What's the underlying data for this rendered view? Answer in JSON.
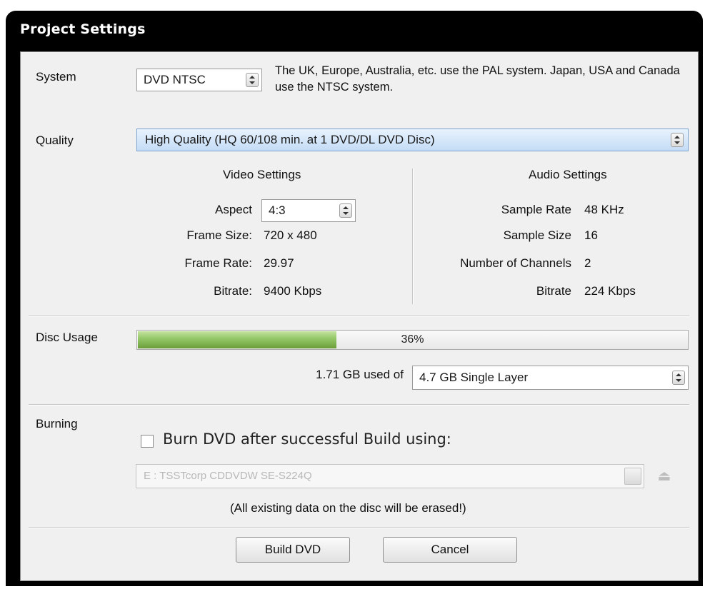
{
  "window": {
    "title": "Project Settings"
  },
  "system": {
    "label": "System",
    "value": "DVD NTSC",
    "description": "The UK, Europe, Australia, etc. use the PAL system. Japan, USA and Canada use the NTSC system."
  },
  "quality": {
    "label": "Quality",
    "value": "High Quality (HQ 60/108 min. at 1 DVD/DL DVD Disc)"
  },
  "video": {
    "heading": "Video Settings",
    "aspect_label": "Aspect",
    "aspect_value": "4:3",
    "frame_size_label": "Frame Size:",
    "frame_size_value": "720 x 480",
    "frame_rate_label": "Frame Rate:",
    "frame_rate_value": "29.97",
    "bitrate_label": "Bitrate:",
    "bitrate_value": "9400 Kbps"
  },
  "audio": {
    "heading": "Audio Settings",
    "sample_rate_label": "Sample Rate",
    "sample_rate_value": "48 KHz",
    "sample_size_label": "Sample Size",
    "sample_size_value": "16",
    "channels_label": "Number of Channels",
    "channels_value": "2",
    "bitrate_label": "Bitrate",
    "bitrate_value": "224 Kbps"
  },
  "disc": {
    "label": "Disc Usage",
    "percent_text": "36%",
    "usage_fraction": 0.36,
    "used_text": "1.71 GB used of",
    "disc_type": "4.7 GB Single Layer"
  },
  "burning": {
    "label": "Burning",
    "checkbox_label": "Burn DVD after successful Build using:",
    "checked": false,
    "drive": "E : TSSTcorp CDDVDW SE-S224Q",
    "warning": "(All existing data on the disc will be erased!)"
  },
  "buttons": {
    "build": "Build DVD",
    "cancel": "Cancel"
  },
  "colors": {
    "progress_green": "#7bb047",
    "quality_highlight": "#c4dcf6",
    "title_bar": "#000000"
  }
}
